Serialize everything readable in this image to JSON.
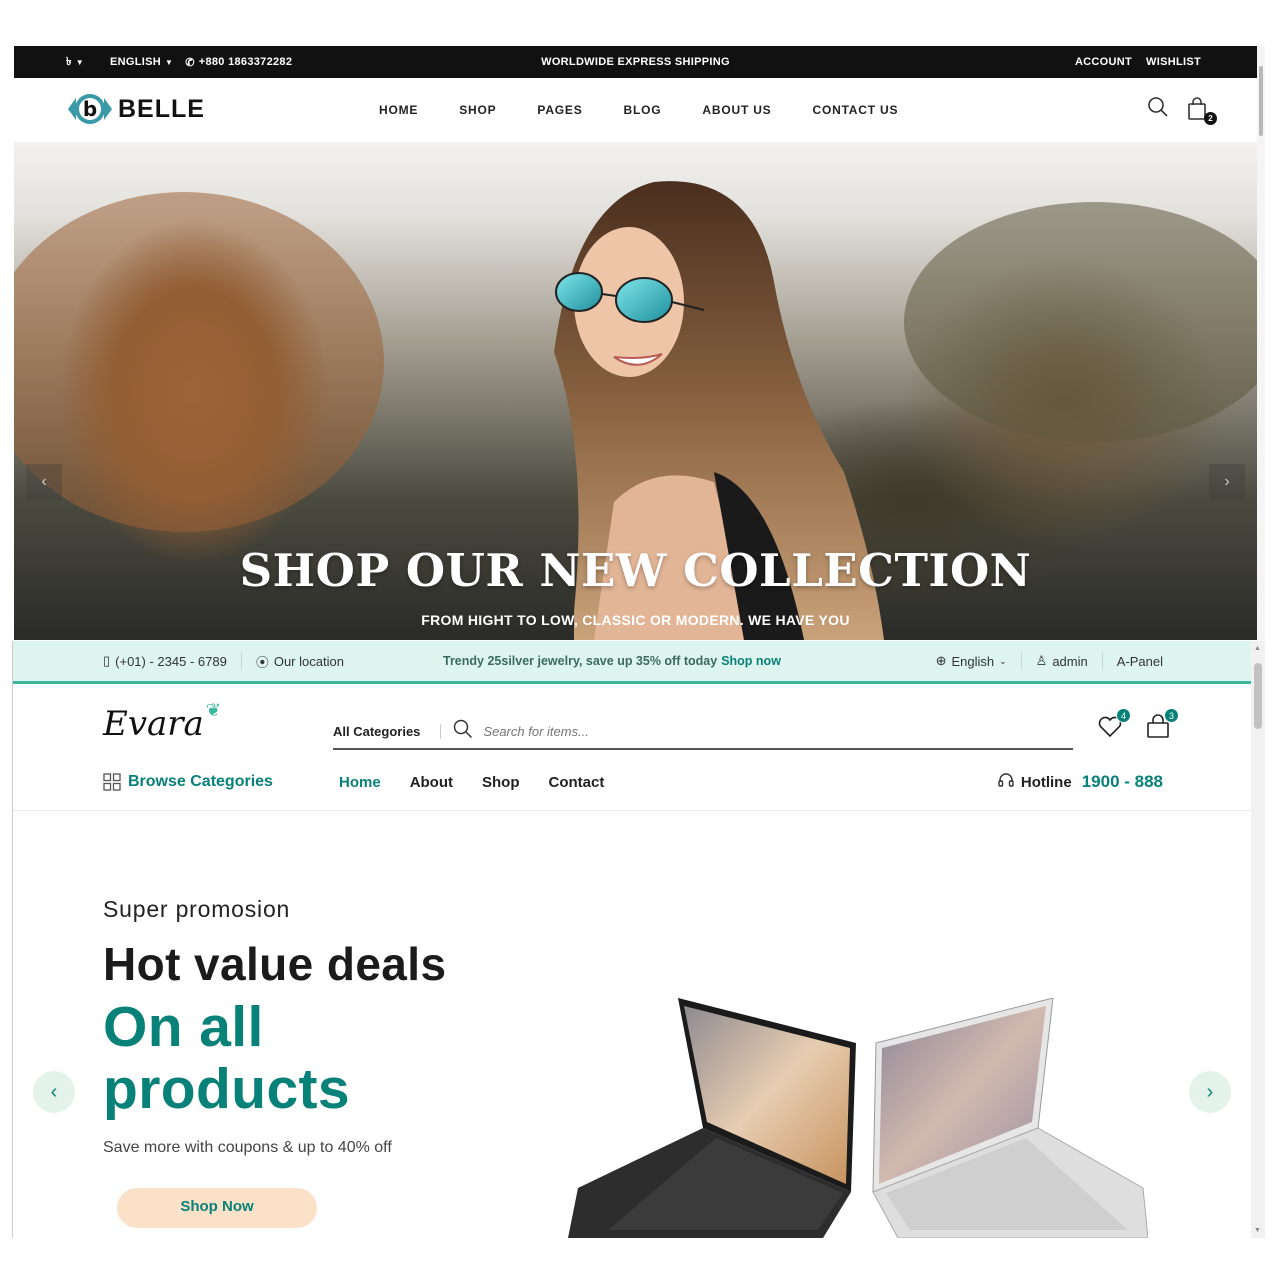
{
  "belle": {
    "topbar": {
      "currency": "৳",
      "language": "ENGLISH",
      "phone": "+880 1863372282",
      "shipping": "WORLDWIDE EXPRESS SHIPPING",
      "account": "ACCOUNT",
      "wishlist": "WISHLIST"
    },
    "logo_text": "BELLE",
    "nav": [
      "HOME",
      "SHOP",
      "PAGES",
      "BLOG",
      "ABOUT US",
      "CONTACT US"
    ],
    "cart_count": "2",
    "hero": {
      "title": "SHOP OUR NEW COLLECTION",
      "subtitle": "FROM HIGHT TO LOW, CLASSIC OR MODERN. WE HAVE YOU"
    }
  },
  "evara": {
    "topbar": {
      "phone": "(+01) - 2345 - 6789",
      "location": "Our location",
      "promo": "Trendy 25silver jewelry, save up 35% off today",
      "promo_link": "Shop now",
      "language": "English",
      "user": "admin",
      "panel": "A-Panel"
    },
    "logo_text": "Evara",
    "search": {
      "category": "All Categories",
      "placeholder": "Search for items..."
    },
    "wishlist_count": "4",
    "cart_count": "3",
    "browse": "Browse Categories",
    "nav": [
      "Home",
      "About",
      "Shop",
      "Contact"
    ],
    "hotline_label": "Hotline",
    "hotline_number": "1900 - 888",
    "hero": {
      "subtitle": "Super promosion",
      "title1": "Hot value deals",
      "title2": "On all",
      "title3": "products",
      "text": "Save more with coupons & up to 40% off",
      "button": "Shop Now"
    }
  },
  "colors": {
    "belle_topbar": "#111111",
    "evara_accent": "#088178",
    "evara_topbar": "#def4ee",
    "evara_button": "#fbe1c8"
  }
}
